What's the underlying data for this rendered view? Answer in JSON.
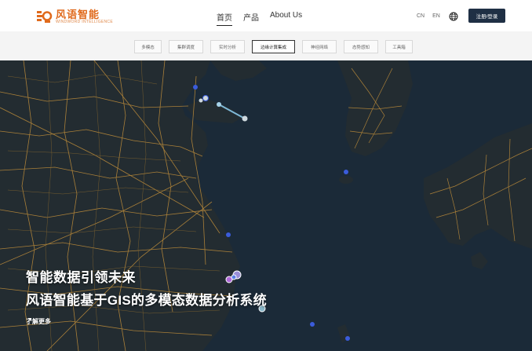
{
  "brand": {
    "name_cn": "风语智能",
    "name_en": "WINDWORD INTELLIGENCE",
    "color": "#e06a1c"
  },
  "nav": {
    "items": [
      {
        "label": "首页",
        "active": true
      },
      {
        "label": "产品"
      },
      {
        "label": "About Us"
      }
    ]
  },
  "lang": {
    "cn": "CN",
    "en": "EN",
    "icon": "globe-icon"
  },
  "auth": {
    "login_label": "注册/登录"
  },
  "tabs": [
    {
      "label": "多模态"
    },
    {
      "label": "集群调度"
    },
    {
      "label": "实时分析"
    },
    {
      "label": "边缘计算集成",
      "active": true
    },
    {
      "label": "神经网络"
    },
    {
      "label": "态势感知"
    },
    {
      "label": "工具箱"
    }
  ],
  "hero": {
    "title_line1": "智能数据引领未来",
    "title_line2": "风语智能基于GIS的多模态数据分析系统",
    "more_label": "了解更多",
    "more_icon": "arrow-up-right-icon",
    "map_colors": {
      "sea": "#1c2b3a",
      "land": "#222b30",
      "roads": "#b48a3a",
      "marker": "#3b5cdb"
    }
  }
}
